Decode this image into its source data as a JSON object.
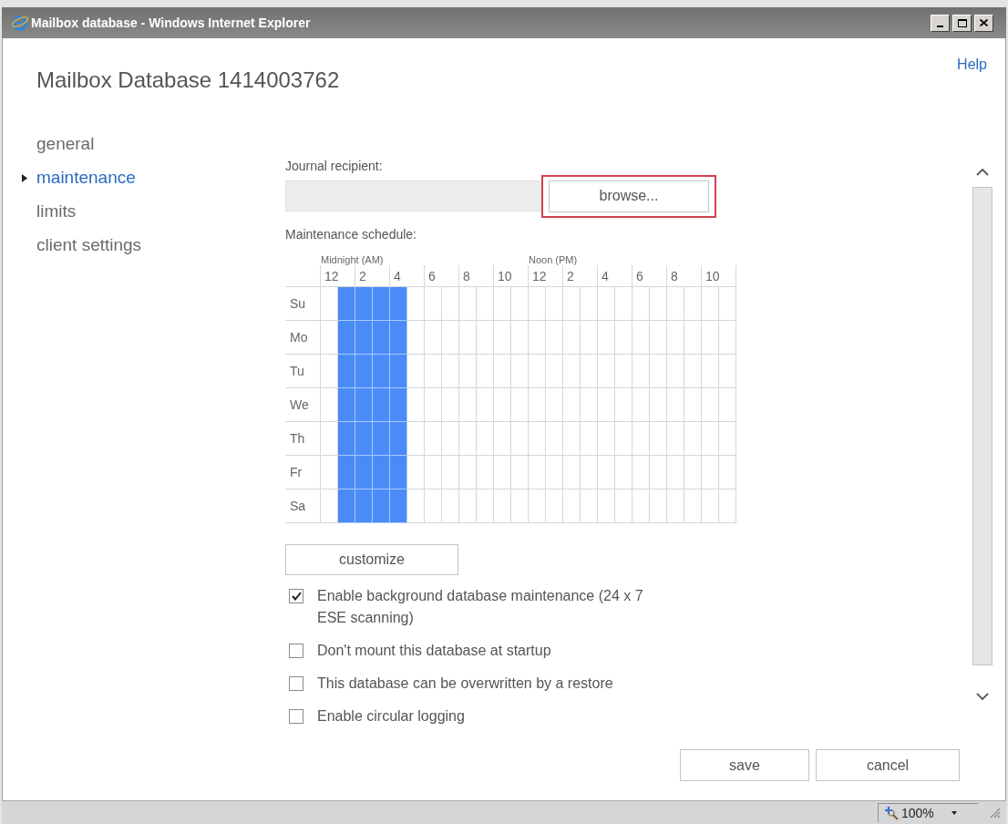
{
  "window": {
    "title": "Mailbox database - Windows Internet Explorer"
  },
  "header": {
    "title": "Mailbox Database 1414003762",
    "help_link": "Help"
  },
  "nav": {
    "items": [
      {
        "label": "general",
        "selected": false
      },
      {
        "label": "maintenance",
        "selected": true
      },
      {
        "label": "limits",
        "selected": false
      },
      {
        "label": "client settings",
        "selected": false
      }
    ]
  },
  "journal": {
    "label": "Journal recipient:",
    "browse_button": "browse...",
    "highlighted": true
  },
  "schedule": {
    "label": "Maintenance schedule:",
    "am_label": "Midnight (AM)",
    "pm_label": "Noon (PM)",
    "hours": [
      "12",
      "2",
      "4",
      "6",
      "8",
      "10",
      "12",
      "2",
      "4",
      "6",
      "8",
      "10"
    ],
    "days": [
      {
        "label": "Su",
        "slots": [
          false,
          true,
          true,
          true,
          true,
          false,
          false,
          false,
          false,
          false,
          false,
          false,
          false,
          false,
          false,
          false,
          false,
          false,
          false,
          false,
          false,
          false,
          false,
          false
        ]
      },
      {
        "label": "Mo",
        "slots": [
          false,
          true,
          true,
          true,
          true,
          false,
          false,
          false,
          false,
          false,
          false,
          false,
          false,
          false,
          false,
          false,
          false,
          false,
          false,
          false,
          false,
          false,
          false,
          false
        ]
      },
      {
        "label": "Tu",
        "slots": [
          false,
          true,
          true,
          true,
          true,
          false,
          false,
          false,
          false,
          false,
          false,
          false,
          false,
          false,
          false,
          false,
          false,
          false,
          false,
          false,
          false,
          false,
          false,
          false
        ]
      },
      {
        "label": "We",
        "slots": [
          false,
          true,
          true,
          true,
          true,
          false,
          false,
          false,
          false,
          false,
          false,
          false,
          false,
          false,
          false,
          false,
          false,
          false,
          false,
          false,
          false,
          false,
          false,
          false
        ]
      },
      {
        "label": "Th",
        "slots": [
          false,
          true,
          true,
          true,
          true,
          false,
          false,
          false,
          false,
          false,
          false,
          false,
          false,
          false,
          false,
          false,
          false,
          false,
          false,
          false,
          false,
          false,
          false,
          false
        ]
      },
      {
        "label": "Fr",
        "slots": [
          false,
          true,
          true,
          true,
          true,
          false,
          false,
          false,
          false,
          false,
          false,
          false,
          false,
          false,
          false,
          false,
          false,
          false,
          false,
          false,
          false,
          false,
          false,
          false
        ]
      },
      {
        "label": "Sa",
        "slots": [
          false,
          true,
          true,
          true,
          true,
          false,
          false,
          false,
          false,
          false,
          false,
          false,
          false,
          false,
          false,
          false,
          false,
          false,
          false,
          false,
          false,
          false,
          false,
          false
        ]
      }
    ]
  },
  "customize_button": "customize",
  "options": [
    {
      "label": "Enable background database maintenance (24 x 7 ESE scanning)",
      "checked": true
    },
    {
      "label": "Don't mount this database at startup",
      "checked": false
    },
    {
      "label": "This database can be overwritten by a restore",
      "checked": false
    },
    {
      "label": "Enable circular logging",
      "checked": false
    }
  ],
  "footer": {
    "buttons": [
      "save",
      "cancel"
    ]
  },
  "status_bar": {
    "zoom": "100%"
  }
}
